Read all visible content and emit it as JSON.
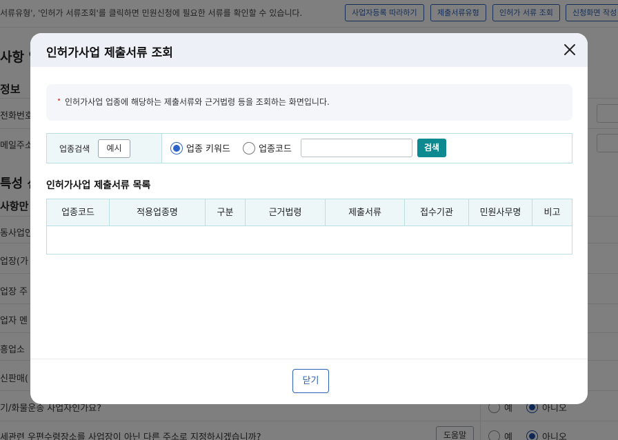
{
  "background": {
    "notice": "서류유형', '인허가 서류조회'를 클릭하면 민원신청에 필요한 서류를 확인할 수 있습니다.",
    "buttons": [
      "사업자등록 따라하기",
      "제출서류유형",
      "인허가 서류 조회",
      "신청화면 작성"
    ],
    "headings": [
      "사항 입",
      "정보",
      "특성 선",
      "사항만"
    ],
    "row_labels": [
      "전화번호",
      "메일주소",
      "동사업인",
      "업장(가",
      "업장 주",
      "업자 멘",
      "흥업소",
      "신판매(",
      "기/화물운송 사업자인가요?",
      "세관련 우편수령장소를 사업장이 아닌 다른 주소로 지정하시겠습니까?"
    ],
    "help_label": "도움말",
    "radio_yes": "예",
    "radio_no": "아니오"
  },
  "modal": {
    "title": "인허가사업 제출서류 조회",
    "info_text": "인허가사업 업종에 해당하는 제출서류와 근거법령 등을 조회하는 화면입니다.",
    "search": {
      "label": "업종검색",
      "example_button": "예시",
      "options": [
        "업종 키워드",
        "업종코드"
      ],
      "selected": "업종 키워드",
      "input_value": "",
      "input_placeholder": "",
      "search_button": "검색"
    },
    "list_title": "인허가사업 제출서류 목록",
    "table": {
      "columns": [
        "업종코드",
        "적용업종명",
        "구분",
        "근거법령",
        "제출서류",
        "접수기관",
        "민원사무명",
        "비고"
      ],
      "rows": []
    },
    "close_button": "닫기"
  },
  "colors": {
    "accent": "#2b5fb3",
    "search_button": "#0d8a8f",
    "table_header_bg": "#eef7f7",
    "modal_header_bg": "#edf1f7",
    "overlay": "rgba(0,0,0,0.5)"
  },
  "icons": {
    "close": "close-x-icon"
  }
}
